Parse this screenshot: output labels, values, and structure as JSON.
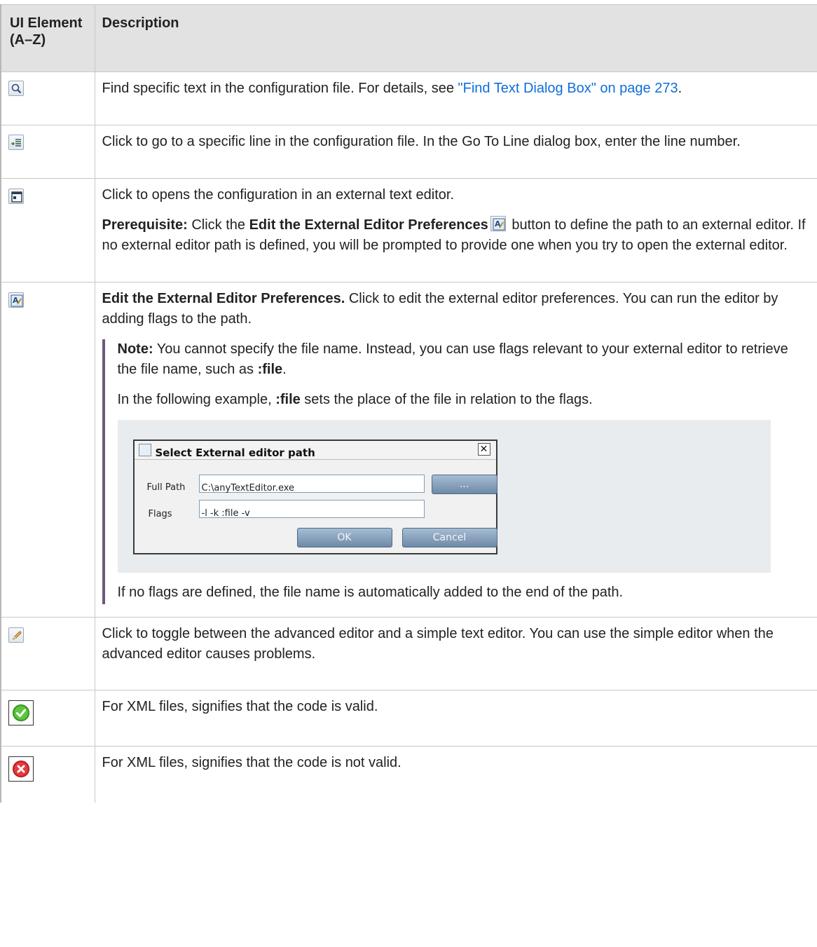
{
  "table": {
    "headers": {
      "element": "UI Element (A–Z)",
      "description": "Description"
    },
    "rows": [
      {
        "icon": "find-text-icon",
        "text": "Find specific text in the configuration file. For details, see ",
        "link": "\"Find Text Dialog Box\" on page 273",
        "suffix": "."
      },
      {
        "icon": "go-to-line-icon",
        "text": "Click to go to a specific line in the configuration file. In the Go To Line dialog box, enter the line number."
      },
      {
        "icon": "external-editor-icon",
        "text": "Click to opens the configuration in an external text editor.",
        "prereq_label": "Prerequisite:",
        "prereq_pre": " Click the ",
        "prereq_bold": "Edit the External Editor Preferences",
        "prereq_post": " button to define the path to an external editor. If no external editor path is defined, you will be prompted to provide one when you try to open the external editor."
      },
      {
        "icon": "edit-preferences-icon",
        "title": "Edit the External Editor Preferences.",
        "text": " Click to edit the external editor preferences. You can run the editor by adding flags to the path.",
        "note_label": "Note:",
        "note_text": "  You cannot specify the file name. Instead, you can use flags relevant to your external editor to retrieve the file name, such as ",
        "note_code": ":file",
        "note_end": ".",
        "example_pre": "In the following example, ",
        "example_code": ":file",
        "example_post": " sets the place of the file in relation to the flags.",
        "after": "If no flags are defined, the file name is automatically added to the end of the path."
      },
      {
        "icon": "pencil-icon",
        "text": "Click to toggle between the advanced editor and a simple text editor. You can use the simple editor when the advanced editor causes problems."
      },
      {
        "icon": "valid-check-icon",
        "text": "For XML files, signifies that the code is valid."
      },
      {
        "icon": "invalid-x-icon",
        "text": "For XML files, signifies that the code is not valid."
      }
    ]
  },
  "dialog": {
    "title": "Select External editor path",
    "full_path_label": "Full Path",
    "full_path_value": "C:\\anyTextEditor.exe",
    "browse_label": "...",
    "flags_label": "Flags",
    "flags_value": "-l -k :file -v",
    "ok_label": "OK",
    "cancel_label": "Cancel",
    "close_glyph": "✕"
  },
  "colors": {
    "header_bg": "#e2e2e2",
    "link": "#0f6ed8",
    "note_bar": "#6b5b7a",
    "valid": "#3fae2a",
    "invalid": "#d9262b"
  }
}
